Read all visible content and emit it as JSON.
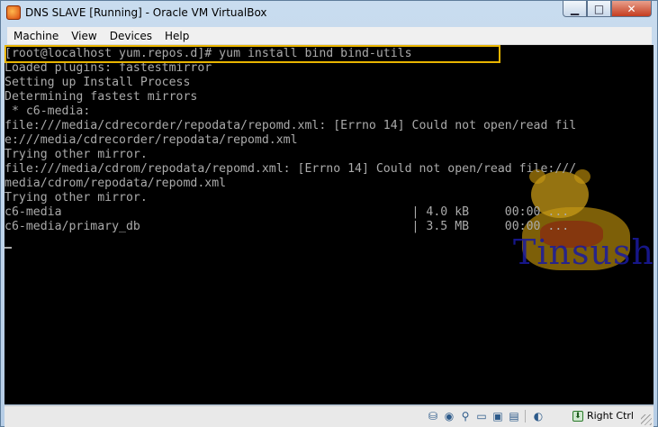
{
  "window": {
    "title": "DNS SLAVE [Running] - Oracle VM VirtualBox",
    "icon": "virtualbox-icon",
    "controls": {
      "minimize": "▁",
      "maximize": "□",
      "close": "✕"
    }
  },
  "menu": {
    "items": [
      {
        "label": "Machine"
      },
      {
        "label": "View"
      },
      {
        "label": "Devices"
      },
      {
        "label": "Help"
      }
    ]
  },
  "terminal": {
    "lines": [
      "[root@localhost yum.repos.d]# yum install bind bind-utils",
      "Loaded plugins: fastestmirror",
      "Setting up Install Process",
      "Determining fastest mirrors",
      " * c6-media:",
      "file:///media/cdrecorder/repodata/repomd.xml: [Errno 14] Could not open/read fil",
      "e:///media/cdrecorder/repodata/repomd.xml",
      "Trying other mirror.",
      "file:///media/cdrom/repodata/repomd.xml: [Errno 14] Could not open/read file:///",
      "media/cdrom/repodata/repomd.xml",
      "Trying other mirror.",
      "c6-media                                                 | 4.0 kB     00:00 ...",
      "c6-media/primary_db                                      | 3.5 MB     00:00 ..."
    ],
    "foreground_color": "#aaaaaa",
    "background_color": "#000000",
    "highlight_color": "#e8b400"
  },
  "watermark": {
    "text": "Tinsush"
  },
  "statusbar": {
    "icons": [
      "hard-disk-icon",
      "optical-drive-icon",
      "usb-icon",
      "shared-folders-icon",
      "display-icon",
      "video-capture-icon",
      "mouse-integration-icon"
    ],
    "host_key": "Right Ctrl"
  }
}
